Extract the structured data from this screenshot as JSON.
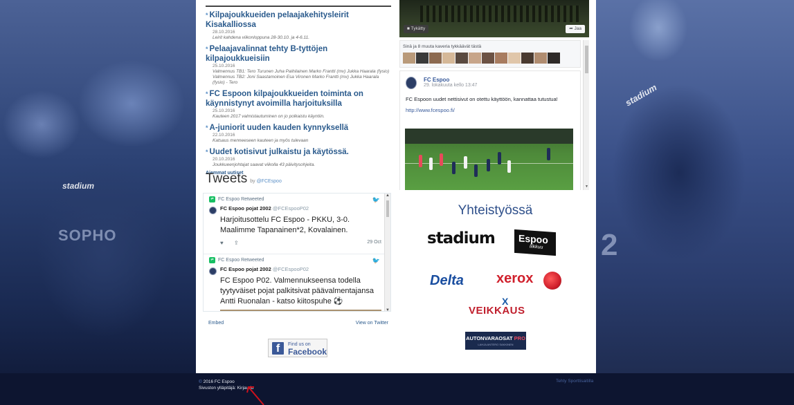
{
  "news": {
    "items": [
      {
        "title": "Kilpajoukkueiden pelaajakehitysleirit Kisakalliossa",
        "date": "28.10.2016",
        "ingress": "Leirit kahdena viikonloppuna 28-30.10. ja 4-6.11."
      },
      {
        "title": "Pelaajavalinnat tehty B-tyttöjen kilpajoukkueisiin",
        "date": "25.10.2016",
        "ingress": "Valmennus TB1: Tero Turunen Juha Paihilainen Marko Frantti (mv) Jukka Haarala (fysio) Valmennus TB2: Joni Saastamoinen Esa Vironen Marko Frantti (mv) Jukka Haarala (fysio) - Tero"
      },
      {
        "title": "FC Espoon kilpajoukkueiden toiminta on käynnistynyt avoimilla harjoituksilla",
        "date": "25.10.2016",
        "ingress": "Kauteen 2017 valmistautuminen on jo polkaistu käyntiin."
      },
      {
        "title": "A-juniorit uuden kauden kynnyksellä",
        "date": "22.10.2016",
        "ingress": "Katsaus menneeseen kauteen ja myös tulevaan"
      },
      {
        "title": "Uudet kotisivut julkaistu ja käytössä.",
        "date": "20.10.2016",
        "ingress": "Joukkueenjohtajat saavat viikolla 43 päivitysohjeita."
      }
    ],
    "more_label": "Aiemmat uutiset"
  },
  "tweets": {
    "title": "Tweets",
    "by_prefix": "by",
    "by_handle": "@FCEspoo",
    "items": [
      {
        "retweeted_label": "FC Espoo Retweeted",
        "name": "FC Espoo pojat 2002",
        "handle": "@FCEspooP02",
        "text": "Harjoitusottelu FC Espoo - PKKU, 3-0. Maalimme Tapanainen*2, Kovalainen.",
        "date": "29 Oct"
      },
      {
        "retweeted_label": "FC Espoo Retweeted",
        "name": "FC Espoo pojat 2002",
        "handle": "@FCEspooP02",
        "text": "FC Espoo P02. Valmennukseensa todella tyytyväiset pojat palkitsivat päävalmentajansa Antti Ruonalan - katso kiitospuhe ⚽"
      }
    ],
    "embed_label": "Embed",
    "view_label": "View on Twitter"
  },
  "facebook_badge": {
    "small": "Find us on",
    "big": "Facebook"
  },
  "fb_widget": {
    "liked_label": "Tykätty",
    "share_label": "Jaa",
    "friends_text": "Sinä ja 8 muuta kaveria tykkäävät tästä",
    "friend_colors": [
      "#b99a7a",
      "#3a3a3a",
      "#8c6a50",
      "#d5b898",
      "#5a4a40",
      "#c7a58a",
      "#6c5244",
      "#a87c60",
      "#e0c6aa",
      "#4a3a30",
      "#b08c70",
      "#2f2a28"
    ],
    "post": {
      "page_name": "FC Espoo",
      "time": "29. lokakuuta kello 13:47",
      "text": "FC Espoon uudet nettisivut on otettu käyttöön, kannattaa tutustua!",
      "link": "http://www.fcespoo.fi/"
    }
  },
  "sponsors": {
    "title": "Yhteistyössä",
    "stadium": "stadium",
    "espoo": "Espoo",
    "espoo_sub": "liikkuu",
    "delta": "Delta",
    "xerox": "xerox",
    "veikkaus": "VEIKKAUS",
    "veikkaus_mark": "X",
    "autonvaraosat": "AUTONVARAOSAT",
    "autonvaraosat_pro": "PRO",
    "autonvaraosat_sub": "LAHJA ANTERO SAKKINEN"
  },
  "background": {
    "shirt_sponsor": "SOPHO",
    "shirt_brand_left": "stadium",
    "shirt_brand_right": "stadium",
    "jersey_number": "2"
  },
  "footer": {
    "copyright_symbol": "©",
    "copyright": "2016 FC Espoo",
    "admin_prefix": "Sivuston ylläpitäjä:",
    "admin_link": "Kirjaudu",
    "credit": "Tehty Sporttisaitilla"
  },
  "colors": {
    "link_blue": "#2a5a8c",
    "sponsor_title": "#2e4f8a",
    "facebook": "#3b5998",
    "twitter": "#1da1f2",
    "retweet": "#17bf63",
    "cursor_arrow": "#d0111c"
  }
}
